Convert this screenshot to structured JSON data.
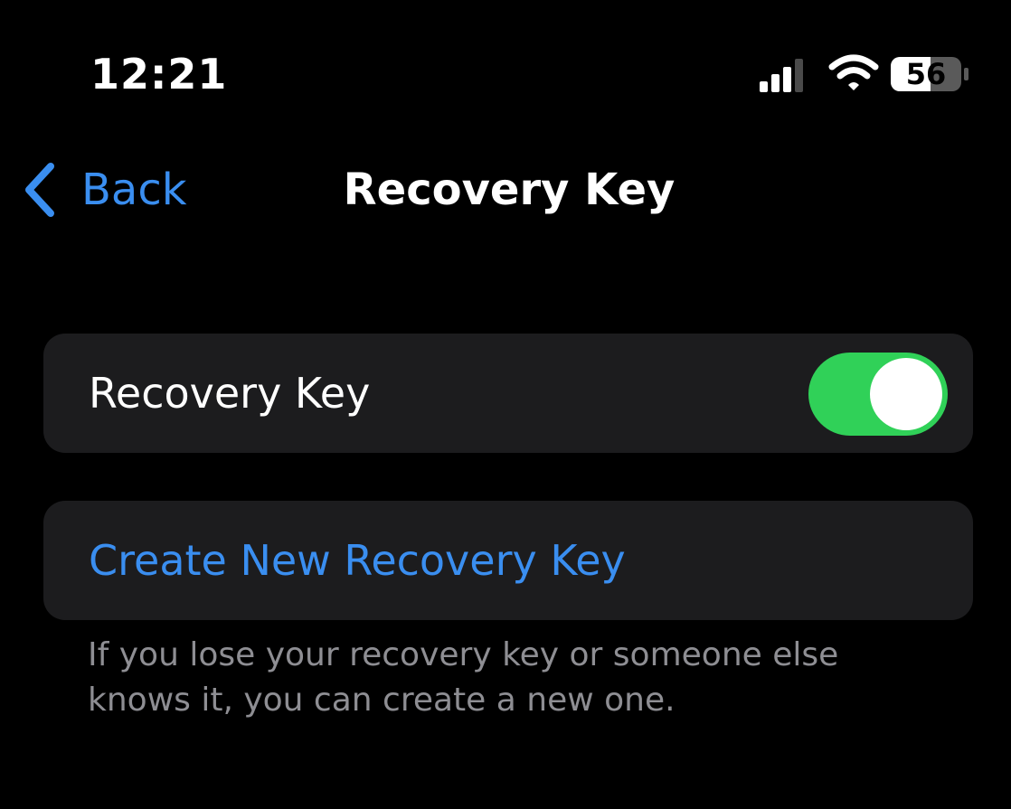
{
  "status_bar": {
    "time": "12:21",
    "battery_level": "56",
    "icons": [
      "cellular-signal-icon",
      "wifi-icon",
      "battery-icon"
    ]
  },
  "nav": {
    "back_label": "Back",
    "title": "Recovery Key"
  },
  "recovery_key_row": {
    "label": "Recovery Key",
    "toggle_on": true
  },
  "create_row": {
    "label": "Create New Recovery Key"
  },
  "footnote": "If you lose your recovery key or someone else knows it, you can create a new one.",
  "colors": {
    "accent": "#3a8ef0",
    "toggle_on": "#30d158",
    "card_bg": "#1c1c1e",
    "footnote": "#8e8e93",
    "background": "#000000"
  }
}
